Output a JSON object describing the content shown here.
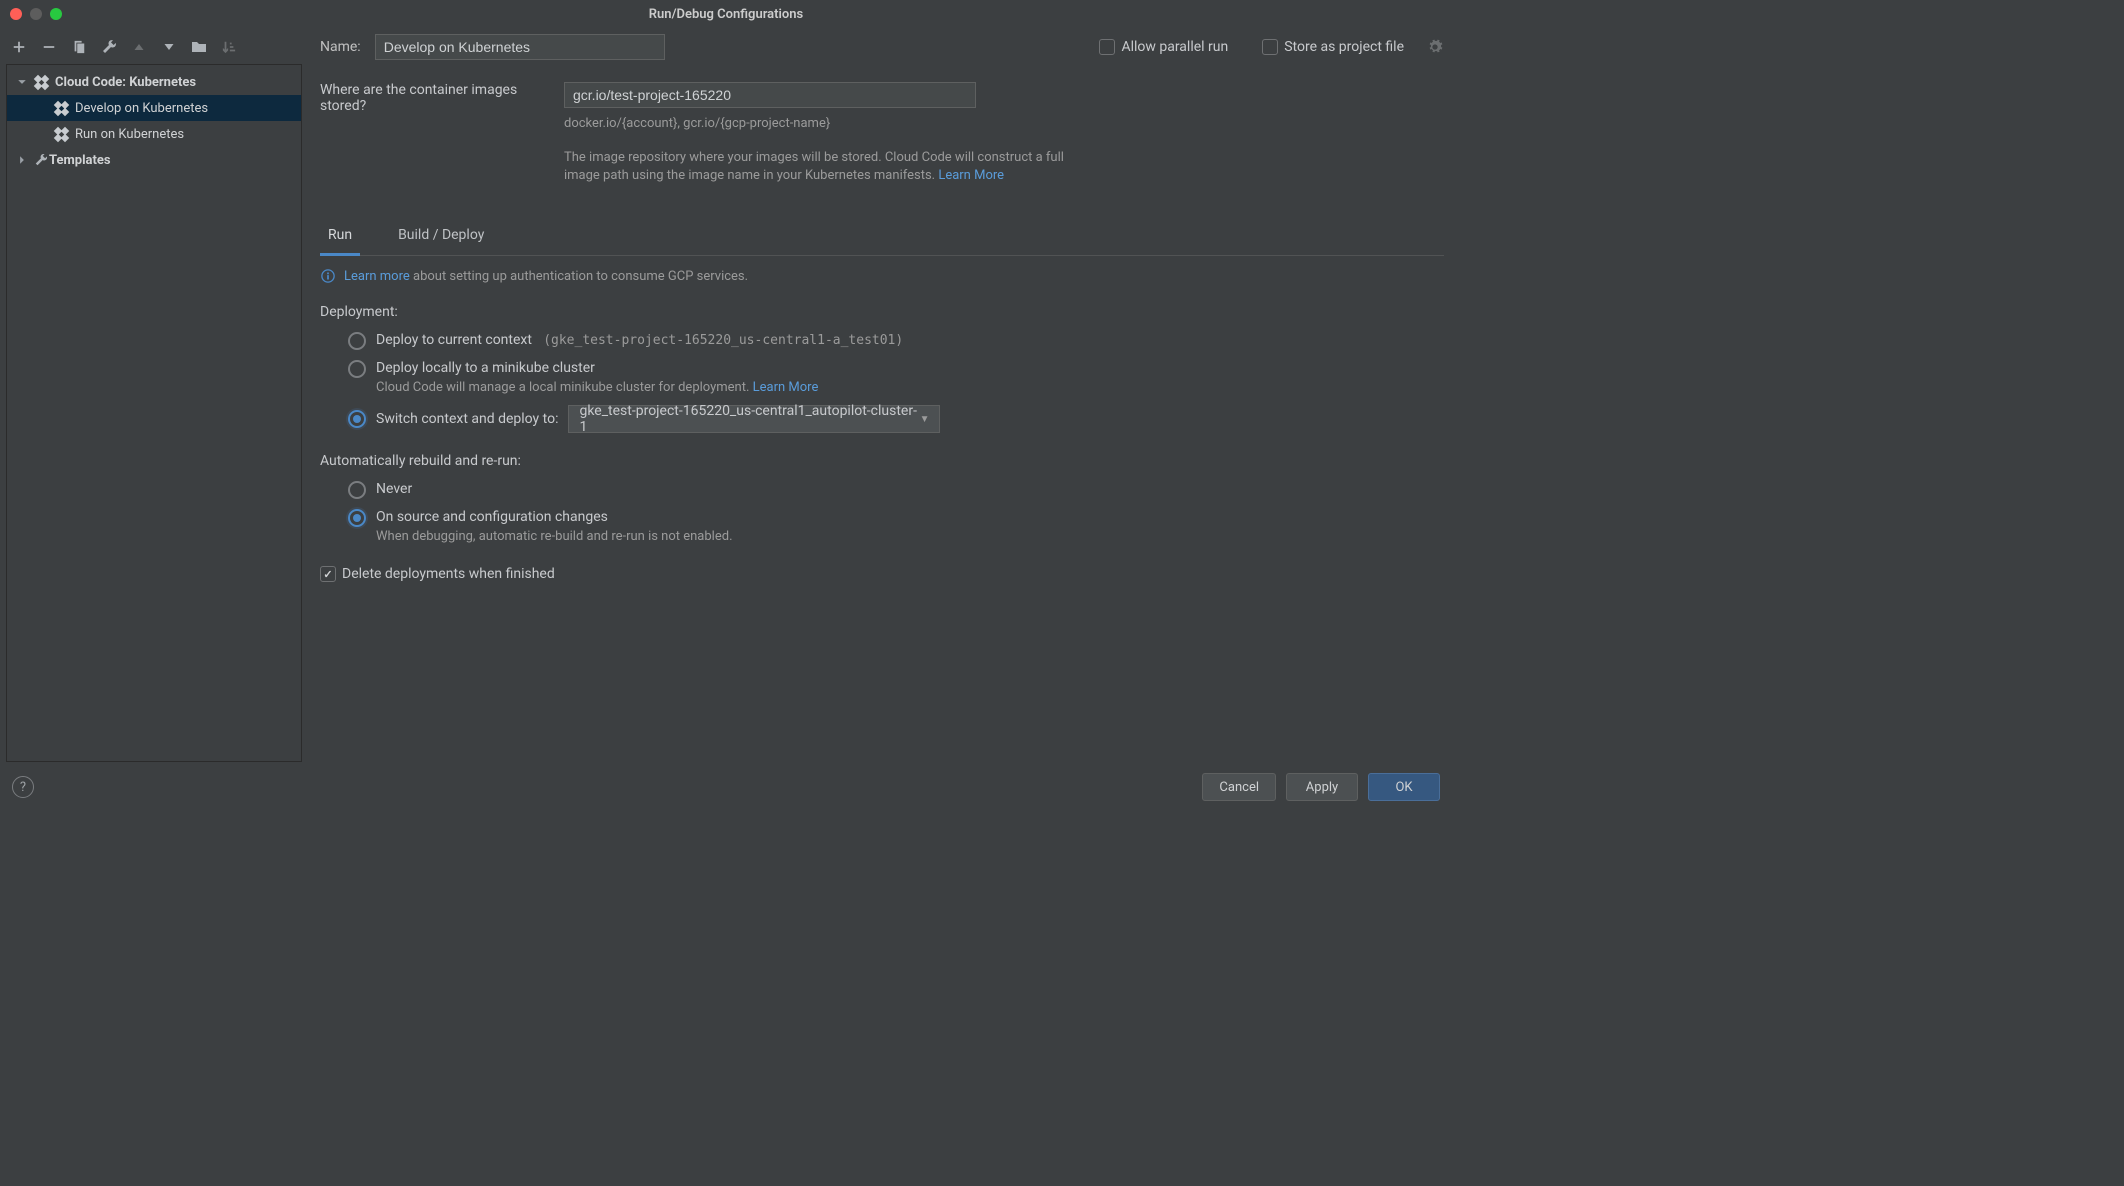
{
  "window": {
    "title": "Run/Debug Configurations"
  },
  "sidebar": {
    "items": [
      {
        "label": "Cloud Code: Kubernetes",
        "kind": "group"
      },
      {
        "label": "Develop on Kubernetes",
        "kind": "config",
        "selected": true
      },
      {
        "label": "Run on Kubernetes",
        "kind": "config"
      },
      {
        "label": "Templates",
        "kind": "templates"
      }
    ]
  },
  "topbar": {
    "name_label": "Name:",
    "name_value": "Develop on Kubernetes",
    "allow_parallel": "Allow parallel run",
    "store_project": "Store as project file"
  },
  "where": {
    "label": "Where are the container images stored?",
    "value": "gcr.io/test-project-165220",
    "hint": "docker.io/{account}, gcr.io/{gcp-project-name}",
    "desc": "The image repository where your images will be stored. Cloud Code will construct a full image path using the image name in your Kubernetes manifests. ",
    "learn_more": "Learn More"
  },
  "tabs": {
    "run": "Run",
    "build": "Build / Deploy"
  },
  "info": {
    "learn_more": "Learn more",
    "text": " about setting up authentication to consume GCP services."
  },
  "deployment": {
    "title": "Deployment:",
    "opt1_label": "Deploy to current context",
    "opt1_context": "(gke_test-project-165220_us-central1-a_test01)",
    "opt2_label": "Deploy locally to a minikube cluster",
    "opt2_sub": "Cloud Code will manage a local minikube cluster for deployment. ",
    "opt2_learn": "Learn More",
    "opt3_label": "Switch context and deploy to:",
    "opt3_value": "gke_test-project-165220_us-central1_autopilot-cluster-1"
  },
  "rebuild": {
    "title": "Automatically rebuild and re-run:",
    "opt1": "Never",
    "opt2": "On source and configuration changes",
    "opt2_sub": "When debugging, automatic re-build and re-run is not enabled."
  },
  "delete_ck": "Delete deployments when finished",
  "footer": {
    "cancel": "Cancel",
    "apply": "Apply",
    "ok": "OK"
  }
}
